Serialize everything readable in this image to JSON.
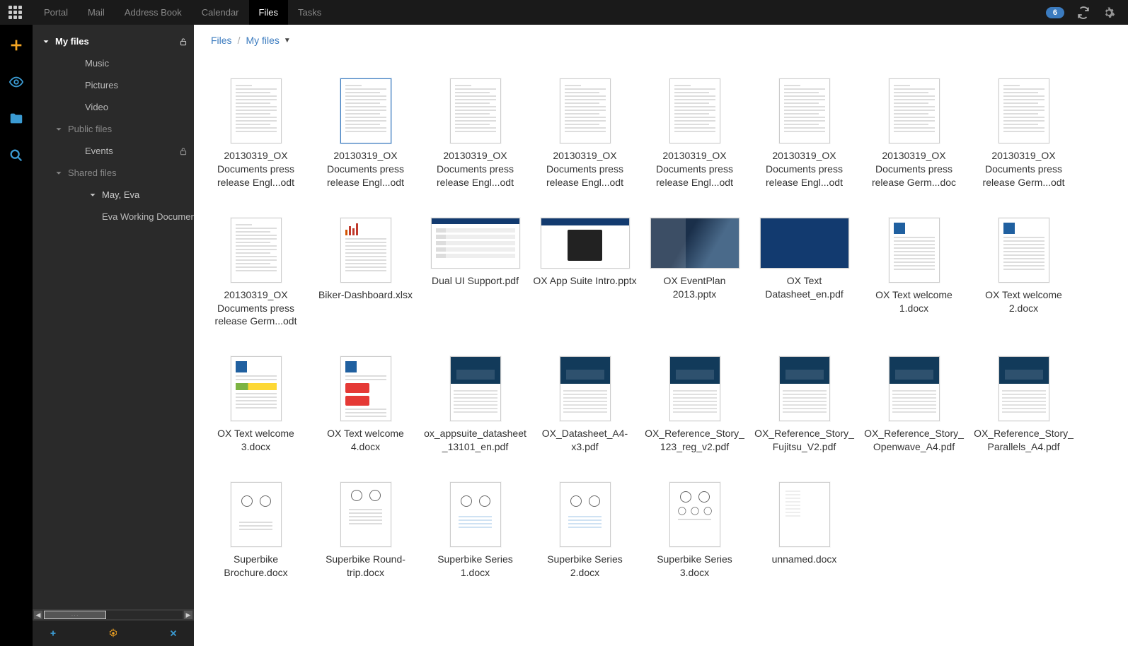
{
  "topnav": {
    "items": [
      "Portal",
      "Mail",
      "Address Book",
      "Calendar",
      "Files",
      "Tasks"
    ],
    "active": "Files",
    "badge": "6"
  },
  "breadcrumb": {
    "root": "Files",
    "current": "My files"
  },
  "sidebar": {
    "tree": [
      {
        "label": "My files",
        "depth": 0,
        "chevron": true,
        "bold": true,
        "lock": true
      },
      {
        "label": "Music",
        "depth": 1
      },
      {
        "label": "Pictures",
        "depth": 1
      },
      {
        "label": "Video",
        "depth": 1
      },
      {
        "label": "Public files",
        "depth": 0,
        "chevron": true,
        "dim": true
      },
      {
        "label": "Events",
        "depth": 1,
        "lock": true
      },
      {
        "label": "Shared files",
        "depth": 0,
        "chevron": true,
        "dim": true
      },
      {
        "label": "May, Eva",
        "depth": 1,
        "chevron": true,
        "indent2": true
      },
      {
        "label": "Eva Working Documents",
        "depth": 3
      }
    ]
  },
  "files": [
    {
      "name": "20130319_OX Documents press release Engl...odt",
      "kind": "doc"
    },
    {
      "name": "20130319_OX Documents press release Engl...odt",
      "kind": "doc",
      "selected": true
    },
    {
      "name": "20130319_OX Documents press release Engl...odt",
      "kind": "doc"
    },
    {
      "name": "20130319_OX Documents press release Engl...odt",
      "kind": "doc"
    },
    {
      "name": "20130319_OX Documents press release Engl...odt",
      "kind": "doc"
    },
    {
      "name": "20130319_OX Documents press release Engl...odt",
      "kind": "doc"
    },
    {
      "name": "20130319_OX Documents press release Germ...doc",
      "kind": "doc"
    },
    {
      "name": "20130319_OX Documents press release Germ...odt",
      "kind": "doc"
    },
    {
      "name": "20130319_OX Documents press release Germ...odt",
      "kind": "doc"
    },
    {
      "name": "Biker-Dashboard.xlsx",
      "kind": "xlsx"
    },
    {
      "name": "Dual UI Support.pdf",
      "kind": "slide-grid"
    },
    {
      "name": "OX App Suite Intro.pptx",
      "kind": "slide-laptop"
    },
    {
      "name": "OX EventPlan 2013.pptx",
      "kind": "slide-photo"
    },
    {
      "name": "OX Text Datasheet_en.pdf",
      "kind": "slide-dark"
    },
    {
      "name": "OX Text welcome 1.docx",
      "kind": "welcome"
    },
    {
      "name": "OX Text welcome 2.docx",
      "kind": "welcome"
    },
    {
      "name": "OX Text welcome 3.docx",
      "kind": "welcome-green"
    },
    {
      "name": "OX Text welcome 4.docx",
      "kind": "welcome-red"
    },
    {
      "name": "ox_appsuite_datasheet_13101_en.pdf",
      "kind": "datasheet"
    },
    {
      "name": "OX_Datasheet_A4-x3.pdf",
      "kind": "datasheet"
    },
    {
      "name": "OX_Reference_Story_123_reg_v2.pdf",
      "kind": "datasheet"
    },
    {
      "name": "OX_Reference_Story_Fujitsu_V2.pdf",
      "kind": "datasheet"
    },
    {
      "name": "OX_Reference_Story_Openwave_A4.pdf",
      "kind": "datasheet"
    },
    {
      "name": "OX_Reference_Story_Parallels_A4.pdf",
      "kind": "datasheet"
    },
    {
      "name": "Superbike Brochure.docx",
      "kind": "bike"
    },
    {
      "name": "Superbike Round-trip.docx",
      "kind": "bike-text"
    },
    {
      "name": "Superbike Series 1.docx",
      "kind": "bike-table"
    },
    {
      "name": "Superbike Series 2.docx",
      "kind": "bike-table"
    },
    {
      "name": "Superbike Series 3.docx",
      "kind": "bike-multi"
    },
    {
      "name": "unnamed.docx",
      "kind": "blank"
    }
  ]
}
